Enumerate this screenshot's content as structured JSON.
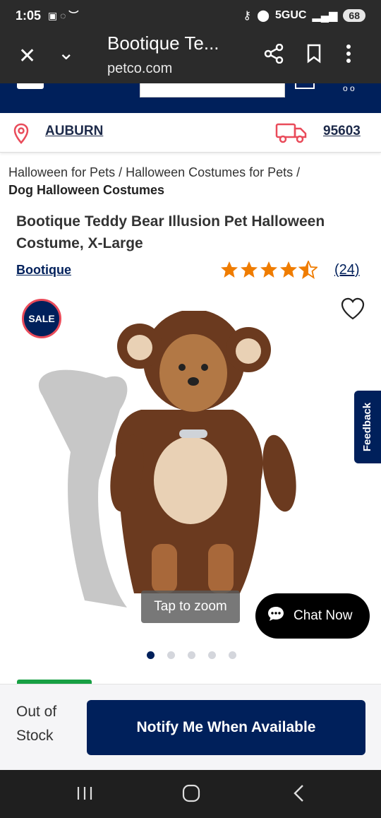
{
  "status_bar": {
    "time": "1:05",
    "network": "5GUC",
    "battery": "68"
  },
  "browser": {
    "tab_title": "Bootique Te...",
    "url": "petco.com"
  },
  "location": {
    "city": "AUBURN",
    "zip": "95603"
  },
  "breadcrumb": {
    "line1": "Halloween for Pets / Halloween Costumes for Pets /",
    "line2": "Dog Halloween Costumes"
  },
  "product": {
    "title": "Bootique Teddy Bear Illusion Pet Halloween Costume, X-Large",
    "brand": "Bootique",
    "rating": 4.5,
    "review_count": "(24)",
    "sale_badge": "SALE"
  },
  "gallery": {
    "zoom_hint": "Tap to zoom",
    "image_count": 5,
    "active_index": 0
  },
  "chat": {
    "label": "Chat Now"
  },
  "feedback": {
    "label": "Feedback"
  },
  "purchase": {
    "stock_status": "Out of Stock",
    "notify_label": "Notify Me When Available"
  },
  "colors": {
    "brand_navy": "#00205b",
    "star_orange": "#ef7c00",
    "sale_red": "#e94b5a"
  }
}
